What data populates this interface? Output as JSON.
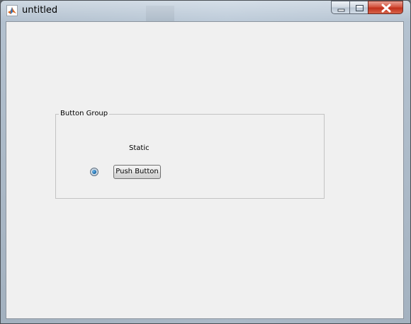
{
  "window": {
    "title": "untitled",
    "icon": "matlab-logo-icon",
    "controls": {
      "minimize_icon": "minimize-icon",
      "maximize_icon": "maximize-icon",
      "close_icon": "close-icon"
    }
  },
  "button_group": {
    "title": "Button Group",
    "static_text": "Static",
    "radio_button": {
      "selected": true,
      "label": ""
    },
    "push_button": {
      "label": "Push Button"
    }
  },
  "colors": {
    "client_background": "#f0f0f0",
    "close_button": "#c2301c",
    "radio_selected": "#1f6fae"
  }
}
